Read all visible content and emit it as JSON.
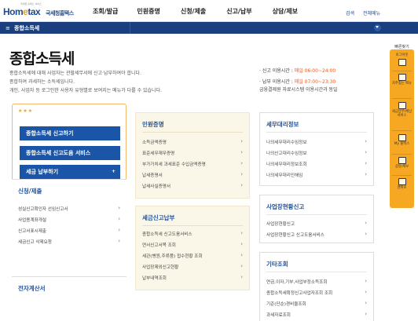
{
  "header": {
    "logo_sub": "국세청 홈택스 서비스",
    "logo_main_pre": "Hom",
    "logo_main_dot": "e",
    "logo_main_post": "tax",
    "logo_kr": "국세청홈택스",
    "menu": [
      "조회/발급",
      "민원증명",
      "신청/제출",
      "신고/납부",
      "상담/제보"
    ],
    "search": "검색",
    "all_menu": "전체메뉴"
  },
  "subbar": {
    "title": "종합소득세"
  },
  "page": {
    "title": "종합소득세",
    "desc": [
      "종합소득세에 대해 사업자는 관할세무서에 신고·납부하여야 합니다.",
      "종합하여 과세하는 소득세입니다.",
      "개인, 사업자 등 로그인한 사용자 유형별로 보여지는 메뉴가 다를 수 있습니다."
    ]
  },
  "notice": {
    "line1_label": "· 신고 이용시간 : ",
    "line1_time": "매일 06:00~24:00",
    "line2_label": "· 납부 이용시간 : ",
    "line2_time": "매일 07:00~23:30",
    "line3": "금융결제원 자료시스템 이용시간과 동일"
  },
  "quick_card": {
    "stars": "★★★",
    "btn1": "종합소득세 신고하기",
    "btn2": "종합소득세 신고도움 서비스",
    "btn3": "세금 납부하기",
    "btn3_plus": "+"
  },
  "sections": {
    "apply": {
      "title": "신청/제출",
      "items": [
        "성실신고확인자 선임신고서",
        "사업용계좌개설",
        "신고서표시제출",
        "세금신고 삭제요청"
      ]
    },
    "einvoice": {
      "title": "전자계산서"
    },
    "civil": {
      "title": "민원증명",
      "items": [
        "소득금액증명",
        "표준세무재무증명",
        "부가가치세 과세표준 수입금액증명",
        "납세증명서",
        "납세사실증명서"
      ]
    },
    "help": {
      "title": "세금신고납부",
      "items": [
        "종합소득세 신고도움서비스",
        "연서신고서목 조회",
        "세관(병원,주류품) 접수현황 조회",
        "사업장제외신고현황",
        "납부내역조회"
      ]
    },
    "tax_agent": {
      "title": "세무대리정보",
      "items": [
        "나의세무대리수임정보",
        "나의신고대리수임정보",
        "나의세무대리정보조회",
        "나의세무대리인해임"
      ]
    },
    "biz": {
      "title": "사업장현황신고",
      "items": [
        "사업장현황신고",
        "사업장현황신고 신고도움서비스"
      ]
    },
    "other": {
      "title": "기타조회",
      "items": [
        "연금,이자,기부,사업부정소득조회",
        "종합소득세확정신고사업자조회 조회",
        "기준(단순)경비율조회",
        "과세자료조회"
      ]
    }
  },
  "quickbar": {
    "top": "빠른찾기",
    "items": [
      "로그아웃",
      "자주찾는 메뉴",
      "세금납부/체납 서비스",
      "My 홈택스",
      "상담/제보",
      "맨위로"
    ]
  }
}
